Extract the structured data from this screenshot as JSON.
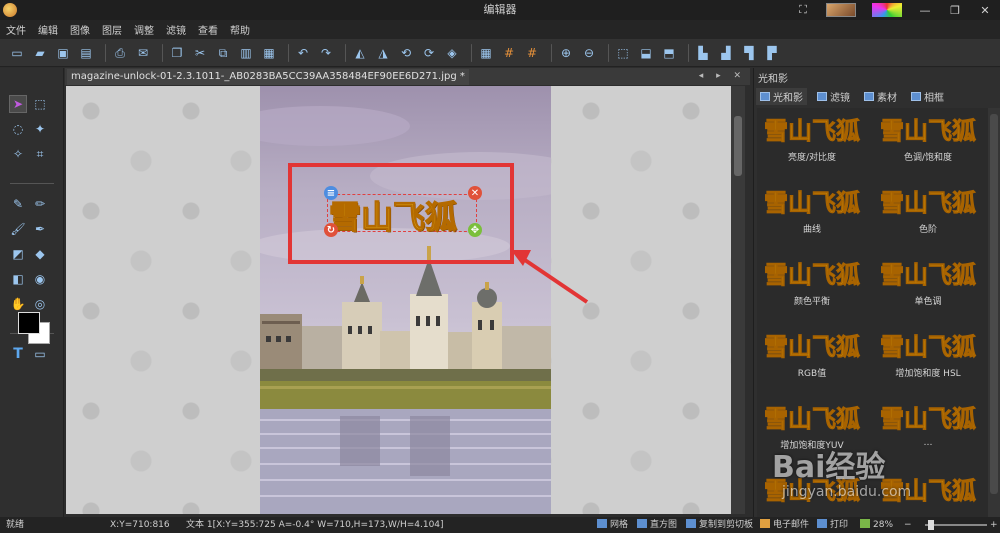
{
  "window": {
    "title": "编辑器",
    "controls": [
      "⛶",
      "—",
      "❐",
      "✕"
    ]
  },
  "menu": [
    "文件",
    "编辑",
    "图像",
    "图层",
    "调整",
    "滤镜",
    "查看",
    "帮助"
  ],
  "toolbar": {
    "icons": [
      "new-file-icon",
      "open-folder-icon",
      "save-icon",
      "save-as-icon",
      "sep",
      "print-icon",
      "email-icon",
      "sep",
      "copy-window-icon",
      "cut-icon",
      "copy-icon",
      "paste-icon",
      "paste-new-icon",
      "sep",
      "undo-icon",
      "redo-icon",
      "sep",
      "flip-horizontal-icon",
      "flip-vertical-icon",
      "rotate-left-icon",
      "rotate-right-icon",
      "free-rotate-icon",
      "sep",
      "grid-icon",
      "grid-hash-icon",
      "grid-hash-alt-icon",
      "sep",
      "zoom-in-icon",
      "zoom-out-icon",
      "sep",
      "select-move-icon",
      "align-icon",
      "distribute-icon",
      "sep",
      "align-left-icon",
      "align-center-icon",
      "align-right-icon",
      "align-bottom-icon"
    ]
  },
  "document": {
    "tab_label": "magazine-unlock-01-2.3.1011-_AB0283BA5CC39AA358484EF90EE6D271.jpg *",
    "nav": "◂ ▸ ✕",
    "caption_text": "雪山飞狐"
  },
  "tools": [
    "pointer-icon",
    "marquee-icon",
    "lasso-icon",
    "magic-wand-icon",
    "polygon-lasso-icon",
    "crop-icon",
    "divider",
    "eyedropper-icon",
    "pencil-icon",
    "brush-icon",
    "airbrush-icon",
    "eraser-icon",
    "drop-icon",
    "fill-icon",
    "clone-icon",
    "smudge-icon",
    "red-eye-icon",
    "divider",
    "text-tool-icon",
    "shape-tool-icon"
  ],
  "colors": {
    "foreground": "#000000",
    "background": "#ffffff",
    "accent": "#e23535",
    "caption_fill": "#f6d21e"
  },
  "right_panel": {
    "title": "光和影",
    "tabs": [
      {
        "label": "光和影",
        "active": true
      },
      {
        "label": "滤镜",
        "active": false
      },
      {
        "label": "素材",
        "active": false
      },
      {
        "label": "相框",
        "active": false
      }
    ],
    "effects": [
      {
        "thumb": "雪山飞狐",
        "label": "亮度/对比度"
      },
      {
        "thumb": "雪山飞狐",
        "label": "色调/饱和度"
      },
      {
        "thumb": "雪山飞狐",
        "label": "曲线"
      },
      {
        "thumb": "雪山飞狐",
        "label": "色阶"
      },
      {
        "thumb": "雪山飞狐",
        "label": "颜色平衡"
      },
      {
        "thumb": "雪山飞狐",
        "label": "单色调"
      },
      {
        "thumb": "雪山飞狐",
        "label": "RGB值"
      },
      {
        "thumb": "雪山飞狐",
        "label": "增加饱和度 HSL"
      },
      {
        "thumb": "雪山飞狐",
        "label": "增加饱和度YUV"
      },
      {
        "thumb": "雪山飞狐",
        "label": "…"
      },
      {
        "thumb": "雪山飞狐",
        "label": ""
      },
      {
        "thumb": "雪山飞狐",
        "label": ""
      }
    ]
  },
  "watermark": {
    "main": "Bai经验",
    "sub": "jingyan.baidu.com"
  },
  "status": {
    "ready": "就绪",
    "cursor": "X:Y=710:816",
    "object_info": "文本 1[X:Y=355:725 A=-0.4° W=710,H=173,W/H=4.104]",
    "grid": "网格",
    "histogram": "直方图",
    "copy_clipboard": "复制到剪切板",
    "email": "电子邮件",
    "print": "打印",
    "zoom": "28%",
    "zoom_out": "−",
    "zoom_in": "+"
  }
}
